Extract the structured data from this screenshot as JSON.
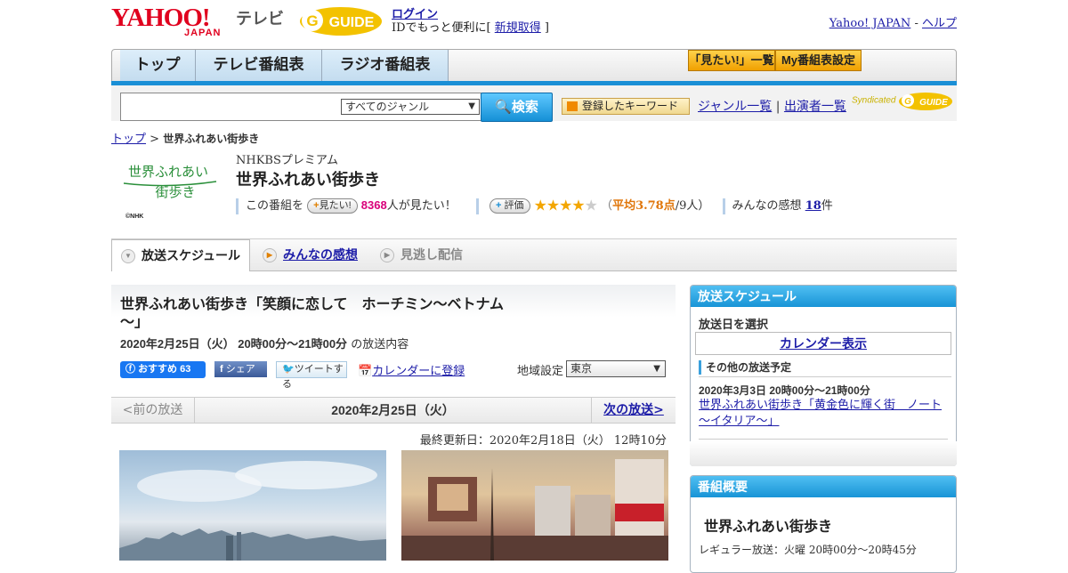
{
  "header": {
    "yahoo_logo": "YAHOO!",
    "yahoo_logo_sub": "JAPAN",
    "tv_label": "テレビ",
    "gguide_logo": "GUIDE",
    "login_link": "ログイン",
    "login_sub_prefix": "IDでもっと便利に[ ",
    "signup_link": "新規取得",
    "login_sub_suffix": " ]",
    "yahoo_japan_link": "Yahoo! JAPAN",
    "link_sep": " - ",
    "help_link": "ヘルプ"
  },
  "nav": {
    "tabs": [
      "トップ",
      "テレビ番組表",
      "ラジオ番組表"
    ],
    "mitai_list": "「見たい!」一覧",
    "my_bangumi": "My番組表設定"
  },
  "search": {
    "input_value": "",
    "genre_selected": "すべてのジャンル",
    "search_button": "検索",
    "keyword_button": "登録したキーワード",
    "genre_list_link": "ジャンル一覧",
    "links_sep": " | ",
    "performer_link": "出演者一覧",
    "syndicated": "Syndicated"
  },
  "breadcrumb": {
    "top": "トップ",
    "sep": " > ",
    "current": "世界ふれあい街歩き"
  },
  "program": {
    "logo_line1": "世界ふれあい",
    "logo_line2": "街歩き",
    "logo_credit": "©NHK",
    "channel": "NHKBSプレミアム",
    "title": "世界ふれあい街歩き",
    "this_program": "この番組を",
    "mitai_chip": "見たい!",
    "mitai_count": "8368",
    "mitai_suffix": "人が見たい！",
    "rate_chip": "評価",
    "rating_open": "（",
    "rating_avg_label": "平均3.78点",
    "rating_count": "/9人）",
    "rating_value": 3.78,
    "rating_max": 5,
    "kanso_label": "みんなの感想",
    "kanso_count": "18",
    "kanso_unit": "件"
  },
  "tabs": {
    "schedule": "放送スケジュール",
    "kanso": "みんなの感想",
    "minogashi": "見逃し配信"
  },
  "episode": {
    "title": "世界ふれあい街歩き「笑顔に恋して　ホーチミン～ベトナム～」",
    "datetime": "2020年2月25日（火）  20時00分～21時00分",
    "datetime_suffix": " の放送内容",
    "fb_recommend": "おすすめ 63",
    "fb_share": "シェア",
    "tweet": "ツイートする",
    "calendar_register": "カレンダーに登録",
    "region_label": "地域設定",
    "region_selected": "東京",
    "prev": "<前の放送",
    "current_date": "2020年2月25日（火）",
    "next": "次の放送>",
    "last_updated": "最終更新日：2020年2月18日（火）  12時10分"
  },
  "sidebar": {
    "schedule_head": "放送スケジュール",
    "select_date": "放送日を選択",
    "calendar_view": "カレンダー表示",
    "other_schedule": "その他の放送予定",
    "other_date": "2020年3月3日  20時00分～21時00分",
    "other_title": "世界ふれあい街歩き「黄金色に輝く街　ノート～イタリア～」",
    "overview_head": "番組概要",
    "overview_title": "世界ふれあい街歩き",
    "overview_regular": "レギュラー放送：火曜 20時00分～20時45分"
  },
  "colors": {
    "accent_blue": "#1a8fd6",
    "yahoo_red": "#e0001e",
    "link": "#1d1da8",
    "count_pink": "#d9007a",
    "rating_orange": "#e0760a",
    "gguide_yellow": "#f3c200"
  }
}
